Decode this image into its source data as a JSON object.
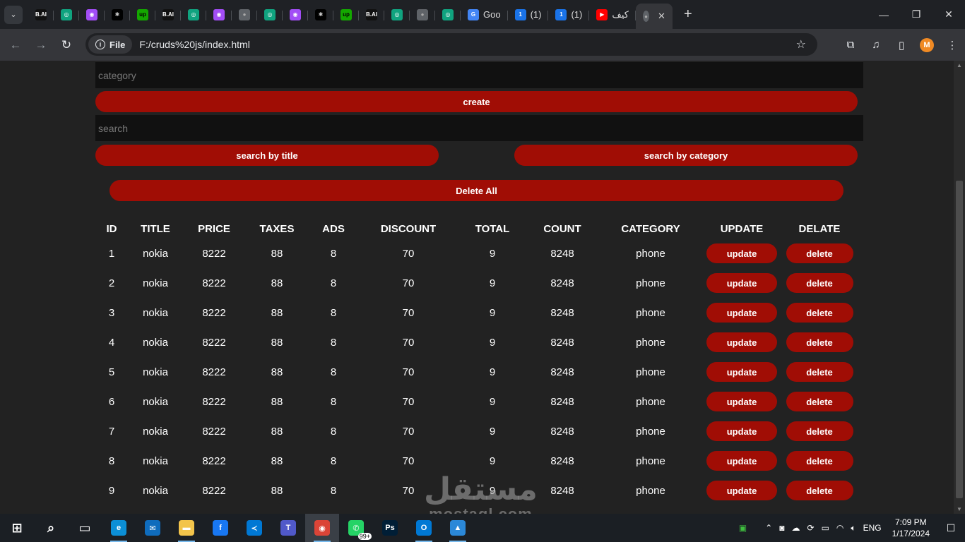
{
  "browser": {
    "tabs": [
      {
        "icon": "bai-icon",
        "glyph": "B.AI",
        "bg": "#111111",
        "fg": "#ffffff",
        "label": ""
      },
      {
        "icon": "chatgpt-icon",
        "glyph": "◎",
        "bg": "#10a37f",
        "fg": "#ffffff",
        "label": ""
      },
      {
        "icon": "robot-icon",
        "glyph": "◉",
        "bg": "#a24df5",
        "fg": "#ffffff",
        "label": ""
      },
      {
        "icon": "perplexity-icon",
        "glyph": "✱",
        "bg": "#000000",
        "fg": "#cccccc",
        "label": ""
      },
      {
        "icon": "upwork-icon",
        "glyph": "up",
        "bg": "#14a800",
        "fg": "#000000",
        "label": ""
      },
      {
        "icon": "bai-icon",
        "glyph": "B.AI",
        "bg": "#111111",
        "fg": "#ffffff",
        "label": ""
      },
      {
        "icon": "chatgpt-icon",
        "glyph": "◎",
        "bg": "#10a37f",
        "fg": "#ffffff",
        "label": ""
      },
      {
        "icon": "robot-icon",
        "glyph": "◉",
        "bg": "#a24df5",
        "fg": "#ffffff",
        "label": ""
      },
      {
        "icon": "globe-icon",
        "glyph": "●",
        "bg": "#5f6368",
        "fg": "#aaaaaa",
        "label": ""
      },
      {
        "icon": "chatgpt-icon",
        "glyph": "◎",
        "bg": "#10a37f",
        "fg": "#ffffff",
        "label": ""
      },
      {
        "icon": "robot-icon",
        "glyph": "◉",
        "bg": "#a24df5",
        "fg": "#ffffff",
        "label": ""
      },
      {
        "icon": "perplexity-icon",
        "glyph": "✱",
        "bg": "#000000",
        "fg": "#cccccc",
        "label": ""
      },
      {
        "icon": "upwork-icon",
        "glyph": "up",
        "bg": "#14a800",
        "fg": "#000000",
        "label": ""
      },
      {
        "icon": "bai-icon",
        "glyph": "B.AI",
        "bg": "#111111",
        "fg": "#ffffff",
        "label": ""
      },
      {
        "icon": "chatgpt-icon",
        "glyph": "◎",
        "bg": "#10a37f",
        "fg": "#ffffff",
        "label": ""
      },
      {
        "icon": "globe-icon",
        "glyph": "●",
        "bg": "#5f6368",
        "fg": "#aaaaaa",
        "label": ""
      },
      {
        "icon": "chatgpt-icon",
        "glyph": "◎",
        "bg": "#10a37f",
        "fg": "#ffffff",
        "label": ""
      },
      {
        "icon": "google-translate-icon",
        "glyph": "G",
        "bg": "#4285f4",
        "fg": "#ffffff",
        "label": "Goo"
      },
      {
        "icon": "gauge-icon",
        "glyph": "1",
        "bg": "#1a73e8",
        "fg": "#ffffff",
        "label": "(1)"
      },
      {
        "icon": "gauge-icon",
        "glyph": "1",
        "bg": "#1a73e8",
        "fg": "#ffffff",
        "label": "(1)"
      },
      {
        "icon": "youtube-icon",
        "glyph": "▶",
        "bg": "#ff0000",
        "fg": "#ffffff",
        "label": "كيف"
      }
    ],
    "active_tab": {
      "icon": "globe-icon",
      "close": "✕"
    },
    "new_tab": "+",
    "window_controls": {
      "minimize": "—",
      "maximize": "❐",
      "close": "✕"
    },
    "nav": {
      "back": "←",
      "forward": "→",
      "reload": "↻"
    },
    "address": {
      "scheme_label": "File",
      "url": "F:/cruds%20js/index.html",
      "info_glyph": "i",
      "star": "☆"
    },
    "toolbar_icons": {
      "extensions": "⧉",
      "media": "♫",
      "sidebar": "▯",
      "menu": "⋮"
    },
    "profile_initial": "M"
  },
  "form": {
    "category_placeholder": "category",
    "create_label": "create",
    "search_placeholder": "search",
    "search_title_label": "search by title",
    "search_category_label": "search by category",
    "delete_all_label": "Delete All"
  },
  "table": {
    "headers": [
      "ID",
      "TITLE",
      "PRICE",
      "TAXES",
      "ADS",
      "DISCOUNT",
      "TOTAL",
      "COUNT",
      "CATEGORY",
      "UPDATE",
      "DELATE"
    ],
    "rows": [
      {
        "id": "1",
        "title": "nokia",
        "price": "8222",
        "taxes": "88",
        "ads": "8",
        "discount": "70",
        "total": "9",
        "count": "8248",
        "category": "phone"
      },
      {
        "id": "2",
        "title": "nokia",
        "price": "8222",
        "taxes": "88",
        "ads": "8",
        "discount": "70",
        "total": "9",
        "count": "8248",
        "category": "phone"
      },
      {
        "id": "3",
        "title": "nokia",
        "price": "8222",
        "taxes": "88",
        "ads": "8",
        "discount": "70",
        "total": "9",
        "count": "8248",
        "category": "phone"
      },
      {
        "id": "4",
        "title": "nokia",
        "price": "8222",
        "taxes": "88",
        "ads": "8",
        "discount": "70",
        "total": "9",
        "count": "8248",
        "category": "phone"
      },
      {
        "id": "5",
        "title": "nokia",
        "price": "8222",
        "taxes": "88",
        "ads": "8",
        "discount": "70",
        "total": "9",
        "count": "8248",
        "category": "phone"
      },
      {
        "id": "6",
        "title": "nokia",
        "price": "8222",
        "taxes": "88",
        "ads": "8",
        "discount": "70",
        "total": "9",
        "count": "8248",
        "category": "phone"
      },
      {
        "id": "7",
        "title": "nokia",
        "price": "8222",
        "taxes": "88",
        "ads": "8",
        "discount": "70",
        "total": "9",
        "count": "8248",
        "category": "phone"
      },
      {
        "id": "8",
        "title": "nokia",
        "price": "8222",
        "taxes": "88",
        "ads": "8",
        "discount": "70",
        "total": "9",
        "count": "8248",
        "category": "phone"
      },
      {
        "id": "9",
        "title": "nokia",
        "price": "8222",
        "taxes": "88",
        "ads": "8",
        "discount": "70",
        "total": "9",
        "count": "8248",
        "category": "phone"
      }
    ],
    "update_label": "update",
    "delete_label": "delete"
  },
  "watermark": {
    "arabic": "مستقل",
    "latin": "mostaql.com"
  },
  "taskbar": {
    "apps": [
      {
        "name": "start-icon",
        "glyph": "⊞",
        "bg": "transparent"
      },
      {
        "name": "search-icon",
        "glyph": "⌕",
        "bg": "transparent"
      },
      {
        "name": "task-view-icon",
        "glyph": "▭",
        "bg": "transparent"
      },
      {
        "name": "edge-icon",
        "glyph": "e",
        "bg": "#0c8fd6"
      },
      {
        "name": "mail-icon",
        "glyph": "✉",
        "bg": "#0f6cbd"
      },
      {
        "name": "file-explorer-icon",
        "glyph": "▬",
        "bg": "#f3c44b"
      },
      {
        "name": "facebook-icon",
        "glyph": "f",
        "bg": "#1877f2"
      },
      {
        "name": "vscode-icon",
        "glyph": "≺",
        "bg": "#0078d4"
      },
      {
        "name": "teams-icon",
        "glyph": "T",
        "bg": "#5059c9"
      },
      {
        "name": "chrome-icon",
        "glyph": "◉",
        "bg": "#db4437"
      },
      {
        "name": "whatsapp-icon",
        "glyph": "✆",
        "bg": "#25d366"
      },
      {
        "name": "photoshop-icon",
        "glyph": "Ps",
        "bg": "#001e36"
      },
      {
        "name": "outlook-icon",
        "glyph": "O",
        "bg": "#0078d4"
      },
      {
        "name": "photos-icon",
        "glyph": "▲",
        "bg": "#2b88d8"
      }
    ],
    "whatsapp_badge": "99+",
    "tray": {
      "language": "ENG",
      "time": "7:09 PM",
      "date": "1/17/2024",
      "notifications": "☐"
    }
  }
}
